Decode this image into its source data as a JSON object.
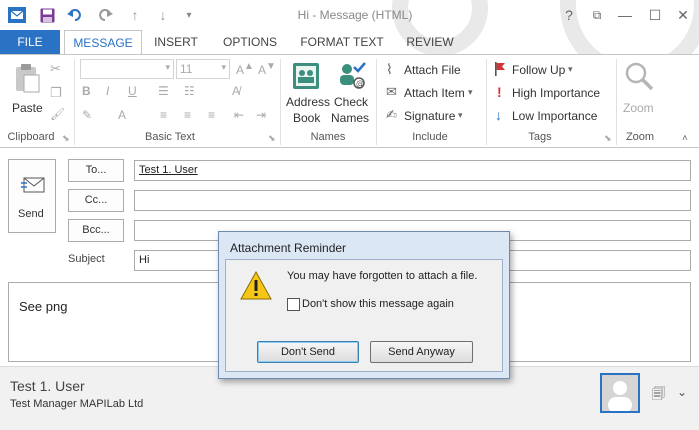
{
  "window": {
    "title": "Hi - Message (HTML)",
    "controls": [
      "?",
      "⧉",
      "—",
      "☐",
      "✕"
    ]
  },
  "tabs": [
    "FILE",
    "MESSAGE",
    "INSERT",
    "OPTIONS",
    "FORMAT TEXT",
    "REVIEW"
  ],
  "ribbon": {
    "clipboard": {
      "paste": "Paste",
      "label": "Clipboard"
    },
    "basic_text": {
      "font_size": "11",
      "label": "Basic Text"
    },
    "names": {
      "address_book": [
        "Address",
        "Book"
      ],
      "check_names": [
        "Check",
        "Names"
      ],
      "label": "Names"
    },
    "include": {
      "attach_file": "Attach File",
      "attach_item": "Attach Item",
      "signature": "Signature",
      "label": "Include"
    },
    "tags": {
      "follow_up": "Follow Up",
      "high_importance": "High Importance",
      "low_importance": "Low Importance",
      "label": "Tags"
    },
    "zoom": {
      "zoom": "Zoom",
      "label": "Zoom"
    }
  },
  "compose": {
    "send": "Send",
    "to_label": "To...",
    "cc_label": "Cc...",
    "bcc_label": "Bcc...",
    "subject_label": "Subject",
    "to_value": "Test 1. User",
    "subject_value": "Hi",
    "body": "See png"
  },
  "footer": {
    "name": "Test 1. User",
    "detail": "Test Manager  MAPILab Ltd"
  },
  "dialog": {
    "title": "Attachment Reminder",
    "message": "You may have forgotten to attach a file.",
    "checkbox_label": "Don't show this message again",
    "checkbox_checked": false,
    "dont_send": "Don't Send",
    "send_anyway": "Send Anyway"
  },
  "colors": {
    "accent": "#2a72c3",
    "dialog_frame": "#dce7f5",
    "warning": "#f5c518"
  }
}
